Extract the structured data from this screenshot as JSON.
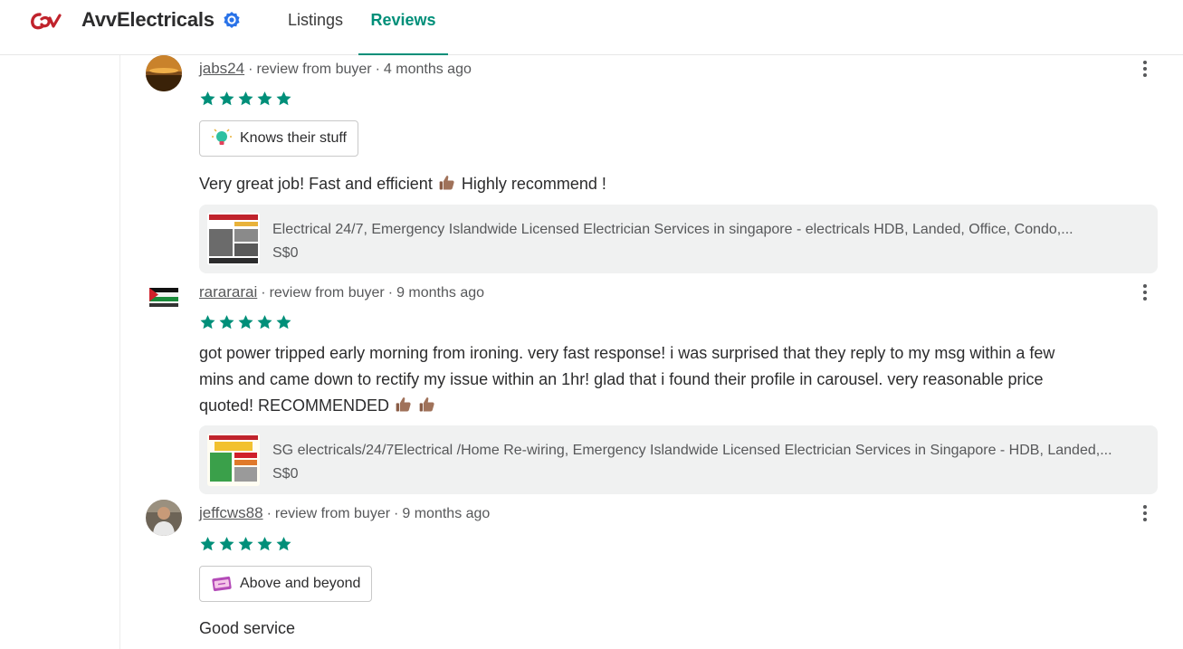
{
  "header": {
    "brand": "AvvElectricals",
    "tabs": [
      {
        "label": "Listings",
        "active": false
      },
      {
        "label": "Reviews",
        "active": true
      }
    ]
  },
  "colors": {
    "accent": "#008f79",
    "logo": "#c0232c",
    "verified": "#2a73e8"
  },
  "reviews": [
    {
      "username": "jabs24",
      "type": "review from buyer",
      "time": "4 months ago",
      "rating": 5,
      "badge": {
        "label": "Knows their stuff",
        "icon": "lightbulb-icon"
      },
      "text_before": "Very great job! Fast and efficient",
      "text_after": "Highly recommend !",
      "listing": {
        "title": "Electrical 24/7, Emergency Islandwide Licensed Electrician Services in singapore - electricals HDB, Landed, Office, Condo,...",
        "price": "S$0"
      }
    },
    {
      "username": "rarararai",
      "type": "review from buyer",
      "time": "9 months ago",
      "rating": 5,
      "text_line1": "got power tripped early morning from ironing. very fast response! i was surprised that they reply to my msg within a few",
      "text_line2": "mins and came down to rectify my issue within an 1hr! glad that i found their profile in carousel. very reasonable price",
      "text_line3": "quoted! RECOMMENDED",
      "listing": {
        "title": "SG electricals/24/7Electrical /Home Re-wiring, Emergency Islandwide Licensed Electrician Services in Singapore - HDB, Landed,...",
        "price": "S$0"
      }
    },
    {
      "username": "jeffcws88",
      "type": "review from buyer",
      "time": "9 months ago",
      "rating": 5,
      "badge": {
        "label": "Above and beyond",
        "icon": "ticket-icon"
      },
      "text": "Good service"
    }
  ]
}
